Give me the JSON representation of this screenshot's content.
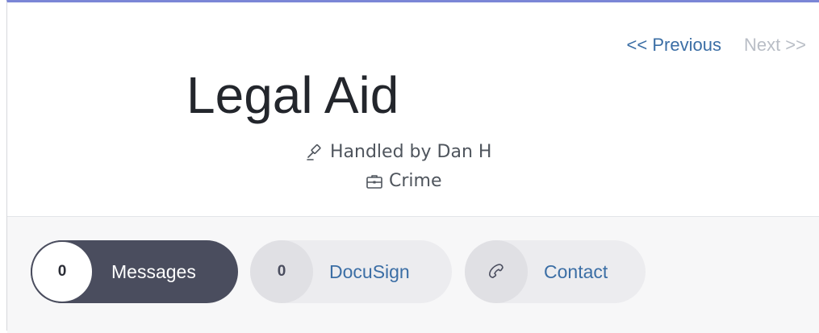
{
  "nav": {
    "previous_label": "<< Previous",
    "next_label": "Next >>"
  },
  "case": {
    "title": "Legal Aid",
    "handled_by": "Handled by Dan H",
    "practice_area": "Crime"
  },
  "actions": [
    {
      "count": "0",
      "label": "Messages",
      "active": true
    },
    {
      "count": "0",
      "label": "DocuSign",
      "active": false
    },
    {
      "icon": "phone-icon",
      "label": "Contact",
      "active": false
    }
  ],
  "colors": {
    "accent_top_border": "#7b86d6",
    "active_pill": "#4a4d5e",
    "inactive_pill": "#ececef",
    "link": "#3b6ea5",
    "disabled_link": "#b9bec6"
  }
}
